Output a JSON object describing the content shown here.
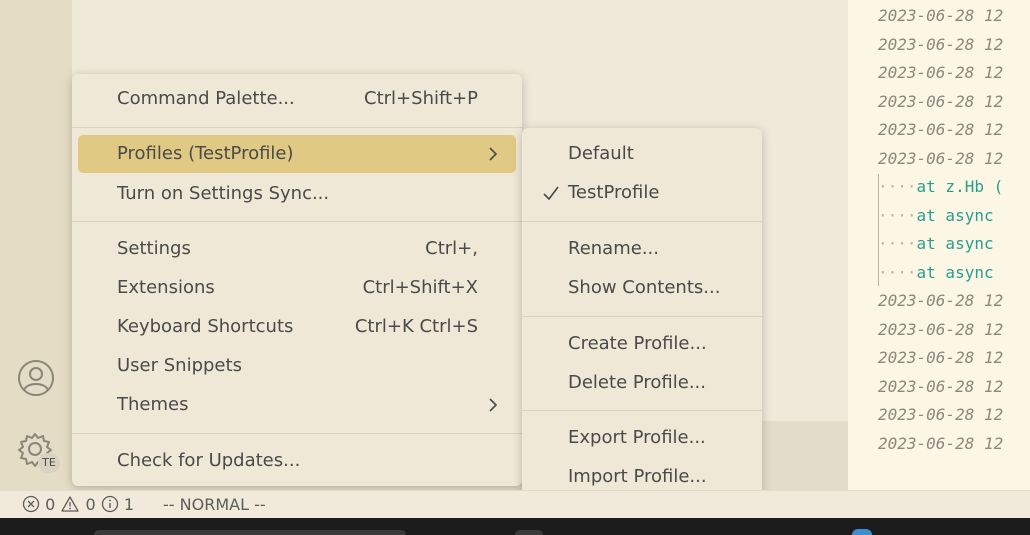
{
  "main_menu": {
    "items": [
      {
        "label": "Command Palette...",
        "shortcut": "Ctrl+Shift+P"
      },
      {
        "label": "Profiles (TestProfile)",
        "shortcut": ""
      },
      {
        "label": "Turn on Settings Sync...",
        "shortcut": ""
      },
      {
        "label": "Settings",
        "shortcut": "Ctrl+,"
      },
      {
        "label": "Extensions",
        "shortcut": "Ctrl+Shift+X"
      },
      {
        "label": "Keyboard Shortcuts",
        "shortcut": "Ctrl+K Ctrl+S"
      },
      {
        "label": "User Snippets",
        "shortcut": ""
      },
      {
        "label": "Themes",
        "shortcut": ""
      },
      {
        "label": "Check for Updates...",
        "shortcut": ""
      }
    ]
  },
  "profiles_menu": {
    "items": [
      {
        "label": "Default"
      },
      {
        "label": "TestProfile",
        "checked": true
      },
      {
        "label": "Rename..."
      },
      {
        "label": "Show Contents..."
      },
      {
        "label": "Create Profile..."
      },
      {
        "label": "Delete Profile..."
      },
      {
        "label": "Export Profile..."
      },
      {
        "label": "Import Profile..."
      }
    ]
  },
  "activity_bar": {
    "accounts_icon": "account-icon",
    "manage_icon": "gear-icon",
    "profile_badge": "TE"
  },
  "editor_right": {
    "log_lines": [
      "2023-06-28 12",
      "2023-06-28 12",
      "2023-06-28 12",
      "2023-06-28 12",
      "2023-06-28 12",
      "2023-06-28 12",
      "2023-06-28 12",
      "2023-06-28 12",
      "2023-06-28 12",
      "2023-06-28 12",
      "2023-06-28 12",
      "2023-06-28 12"
    ],
    "stack_lines": [
      {
        "dots": "····",
        "text": "at z.Hb (",
        "extra": "("
      },
      {
        "dots": "····",
        "text": "at async ",
        "extra": ""
      },
      {
        "dots": "····",
        "text": "at async ",
        "extra": ""
      },
      {
        "dots": "····",
        "text": "at async ",
        "extra": ""
      }
    ]
  },
  "status_bar": {
    "errors": "0",
    "warnings": "0",
    "info": "1",
    "mode": "-- NORMAL --"
  },
  "colors": {
    "menu_bg": "#efe8d6",
    "highlight": "#dfc983",
    "accent_teal": "#2a9d8f"
  }
}
